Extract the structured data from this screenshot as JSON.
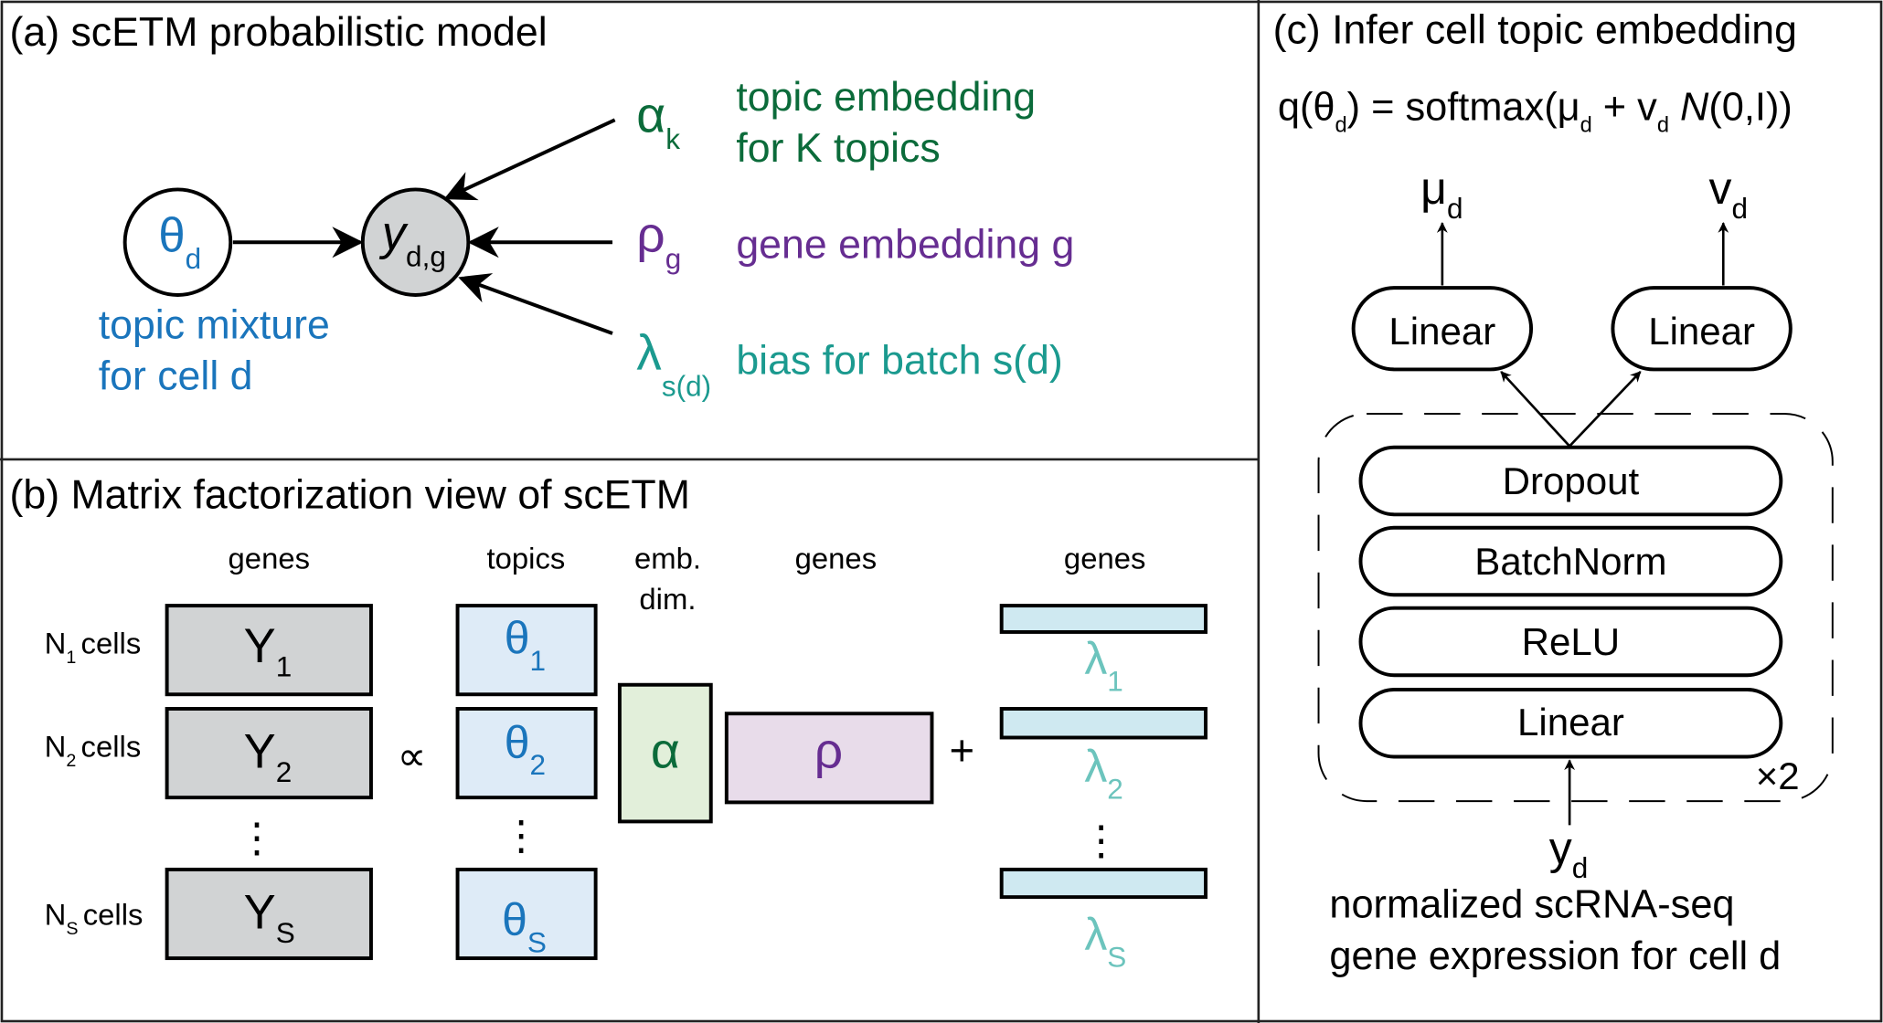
{
  "colors": {
    "blue": "#1a75bc",
    "green": "#0b6b3a",
    "purple": "#662d91",
    "teal": "#1b9a8f",
    "light_teal": "#6cc4bd",
    "node_gray": "#d1d3d4",
    "theta_fill": "#deebf7",
    "alpha_fill": "#e2efda",
    "rho_fill": "#e8dcea",
    "lambda_fill": "#cfe9f1"
  },
  "panel_a": {
    "title": "(a) scETM probabilistic model",
    "theta": {
      "symbol": "θ",
      "sub": "d"
    },
    "y": {
      "symbol": "y",
      "sub": "d,g"
    },
    "theta_label": [
      "topic mixture",
      "for cell d"
    ],
    "alpha": {
      "symbol": "α",
      "sub": "k",
      "label": [
        "topic embedding",
        "for K topics"
      ]
    },
    "rho": {
      "symbol": "ρ",
      "sub": "g",
      "label": "gene embedding g"
    },
    "lambda": {
      "symbol": "λ",
      "sub": "s(d)",
      "label": "bias for batch s(d)"
    }
  },
  "panel_b": {
    "title": "(b) Matrix factorization view of scETM",
    "headers": {
      "y_genes": "genes",
      "topics": "topics",
      "emb": "emb.",
      "dim": "dim.",
      "rho_genes": "genes",
      "lambda_genes": "genes"
    },
    "rows": [
      {
        "n": "N",
        "n_sub": "1",
        "cells": "cells",
        "y": "Y",
        "y_sub": "1",
        "theta": "θ",
        "theta_sub": "1",
        "lambda": "λ",
        "lambda_sub": "1"
      },
      {
        "n": "N",
        "n_sub": "2",
        "cells": "cells",
        "y": "Y",
        "y_sub": "2",
        "theta": "θ",
        "theta_sub": "2",
        "lambda": "λ",
        "lambda_sub": "2"
      },
      {
        "n": "N",
        "n_sub": "S",
        "cells": "cells",
        "y": "Y",
        "y_sub": "S",
        "theta": "θ",
        "theta_sub": "S",
        "lambda": "λ",
        "lambda_sub": "S"
      }
    ],
    "ellipsis": "⋮",
    "propto": "∝",
    "alpha": "α",
    "rho": "ρ",
    "plus": "+"
  },
  "panel_c": {
    "title": "(c) Infer cell topic embedding",
    "formula": {
      "q": "q(θ",
      "q_sub": "d",
      "eq": ") = softmax(μ",
      "mu_sub": "d",
      "plus": " + v",
      "v_sub": "d",
      "space": " ",
      "N": "N",
      "tail": "(0,I))"
    },
    "mu": {
      "symbol": "μ",
      "sub": "d"
    },
    "v": {
      "symbol": "v",
      "sub": "d"
    },
    "linear_left": "Linear",
    "linear_right": "Linear",
    "stack": [
      "Dropout",
      "BatchNorm",
      "ReLU",
      "Linear"
    ],
    "repeat": "×2",
    "input": {
      "symbol": "y",
      "sub": "d"
    },
    "caption": [
      "normalized scRNA-seq",
      "gene expression for cell d"
    ]
  }
}
